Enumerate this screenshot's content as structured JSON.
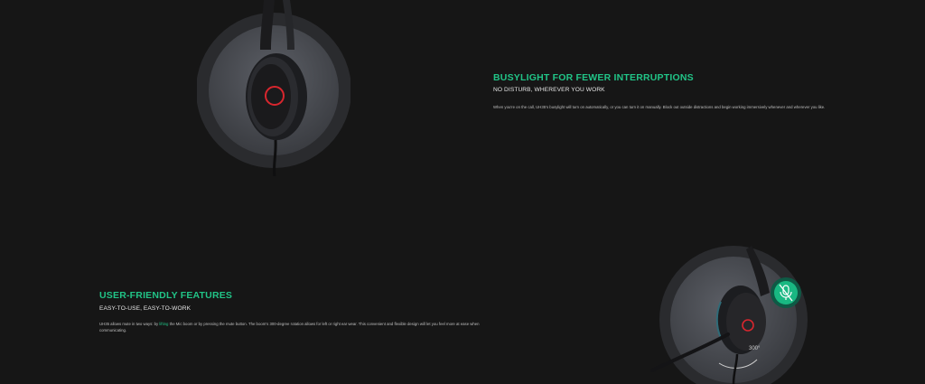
{
  "sections": [
    {
      "title": "BUSYLIGHT FOR FEWER INTERRUPTIONS",
      "subtitle": "NO DISTURB, WHEREVER YOU WORK",
      "body": "When you're on the call, UH35's busylight will turn on automatically, or you can turn it on manually. Block out outside distractions and begin working immersively whenever and wherever you like."
    },
    {
      "title": "USER-FRIENDLY FEATURES",
      "subtitle": "EASY-TO-USE, EASY-TO-WORK",
      "body_pre": "UH35 allows mute in two ways: by ",
      "body_highlight": "lifting",
      "body_post": " the Mic boom or by pressing the mute button. The boom's 300-degree rotation allows for left or right ear wear. This convenient and flexible design will let you feel more at ease when communicating."
    }
  ],
  "rotation_label": "300°",
  "icons": [
    "busylight-headset-image",
    "mute-mic-icon",
    "rotating-boom-headset-image"
  ],
  "colors": {
    "accent": "#21c487",
    "background": "#161616",
    "busylight_red": "#d8262e"
  }
}
